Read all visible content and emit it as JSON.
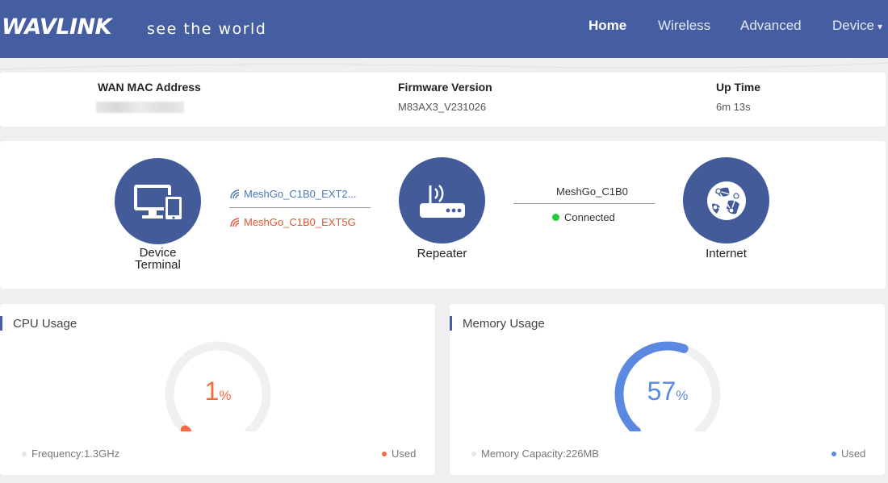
{
  "header": {
    "brand": "WAVLINK",
    "tagline": "see the world",
    "nav": [
      {
        "label": "Home"
      },
      {
        "label": "Wireless"
      },
      {
        "label": "Advanced"
      },
      {
        "label": "Device"
      }
    ],
    "nav_caret": "▾",
    "color": "#455ea1"
  },
  "info": {
    "wan_mac": {
      "label": "WAN MAC Address",
      "value": ""
    },
    "firmware": {
      "label": "Firmware Version",
      "value": "M83AX3_V231026"
    },
    "uptime": {
      "label": "Up Time",
      "value": "6m 13s"
    }
  },
  "topology": {
    "device_terminal": {
      "label_line1": "Device",
      "label_line2": "Terminal",
      "icon": "devices-icon"
    },
    "repeater": {
      "label": "Repeater",
      "icon": "router-icon"
    },
    "internet": {
      "label": "Internet",
      "icon": "globe-icon"
    },
    "ssid_24g": "MeshGo_C1B0_EXT2...",
    "ssid_5g": "MeshGo_C1B0_EXT5G",
    "uplink_ssid": "MeshGo_C1B0",
    "uplink_status": "Connected",
    "ssid_24g_color": "#4a78b7",
    "ssid_5g_color": "#e4532f",
    "connected_color": "#1ccd3c"
  },
  "cpu": {
    "title": "CPU Usage",
    "value": "1",
    "unit": "%",
    "percent": 1,
    "frequency": "Frequency:1.3GHz",
    "legend": "Used",
    "color": "#f36b3f"
  },
  "memory": {
    "title": "Memory Usage",
    "value": "57",
    "unit": "%",
    "percent": 57,
    "capacity": "Memory Capacity:226MB",
    "legend": "Used",
    "color": "#5b88e0"
  }
}
